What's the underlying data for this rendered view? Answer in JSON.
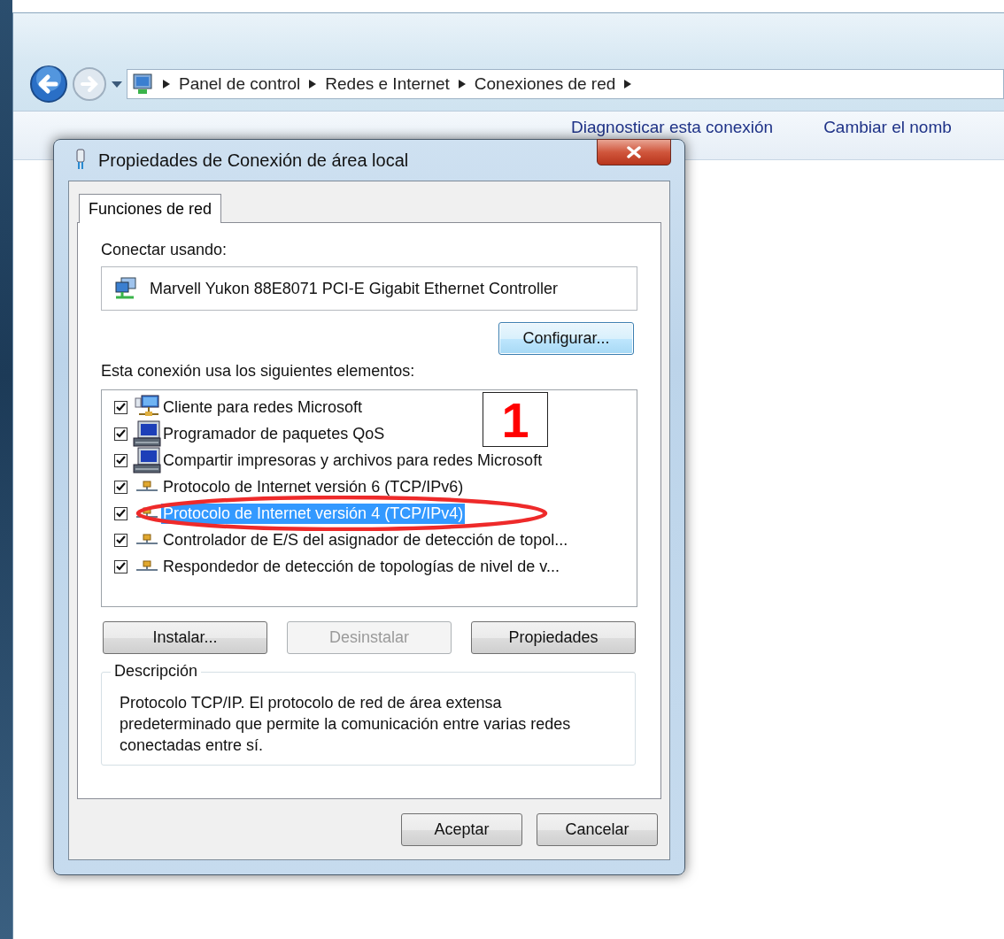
{
  "explorer": {
    "breadcrumbs": [
      "Panel de control",
      "Redes e Internet",
      "Conexiones de red"
    ],
    "toolbar": [
      "Diagnosticar esta conexión",
      "Cambiar el nomb"
    ]
  },
  "dialog": {
    "title": "Propiedades de Conexión de área local",
    "tabs": [
      {
        "label": "Funciones de red",
        "selected": true
      }
    ],
    "connect_label": "Conectar usando:",
    "adapter": "Marvell Yukon 88E8071 PCI-E Gigabit Ethernet Controller",
    "configure_button": "Configurar...",
    "items_label": "Esta conexión usa los siguientes elementos:",
    "items": [
      {
        "label": "Cliente para redes Microsoft",
        "kind": "client",
        "checked": true,
        "selected": false,
        "circled": false
      },
      {
        "label": "Programador de paquetes QoS",
        "kind": "computer",
        "checked": true,
        "selected": false,
        "circled": false
      },
      {
        "label": "Compartir impresoras y archivos para redes Microsoft",
        "kind": "computer",
        "checked": true,
        "selected": false,
        "circled": false
      },
      {
        "label": "Protocolo de Internet versión 6 (TCP/IPv6)",
        "kind": "protocol",
        "checked": true,
        "selected": false,
        "circled": false
      },
      {
        "label": "Protocolo de Internet versión 4 (TCP/IPv4)",
        "kind": "protocol",
        "checked": true,
        "selected": true,
        "circled": true
      },
      {
        "label": "Controlador de E/S del asignador de detección de topol...",
        "kind": "protocol",
        "checked": true,
        "selected": false,
        "circled": false
      },
      {
        "label": "Respondedor de detección de topologías de nivel de v...",
        "kind": "protocol",
        "checked": true,
        "selected": false,
        "circled": false
      }
    ],
    "buttons": [
      {
        "label": "Instalar...",
        "disabled": false
      },
      {
        "label": "Desinstalar",
        "disabled": true
      },
      {
        "label": "Propiedades",
        "disabled": false
      }
    ],
    "description": {
      "legend": "Descripción",
      "text": "Protocolo TCP/IP. El protocolo de red de área extensa predeterminado que permite la comunicación entre varias redes conectadas entre sí."
    },
    "footer_buttons": [
      "Aceptar",
      "Cancelar"
    ]
  },
  "annotation": {
    "badge": "1"
  }
}
